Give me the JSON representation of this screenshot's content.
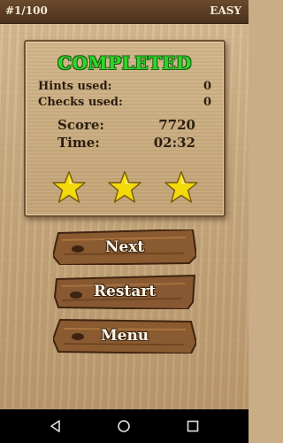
{
  "header": {
    "level": "#1/100",
    "difficulty": "EASY"
  },
  "result": {
    "title": "COMPLETED",
    "hints_label": "Hints used:",
    "hints_value": "0",
    "checks_label": "Checks used:",
    "checks_value": "0",
    "score_label": "Score:",
    "score_value": "7720",
    "time_label": "Time:",
    "time_value": "02:32",
    "stars_earned": 3,
    "stars_total": 3
  },
  "buttons": {
    "next": "Next",
    "restart": "Restart",
    "menu": "Menu"
  },
  "navbar": {
    "icons": [
      "back-icon",
      "home-icon",
      "recents-icon"
    ]
  },
  "colors": {
    "title_green": "#2fd72a",
    "star_yellow": "#f4d90b",
    "topbar": "#5a3d24"
  }
}
